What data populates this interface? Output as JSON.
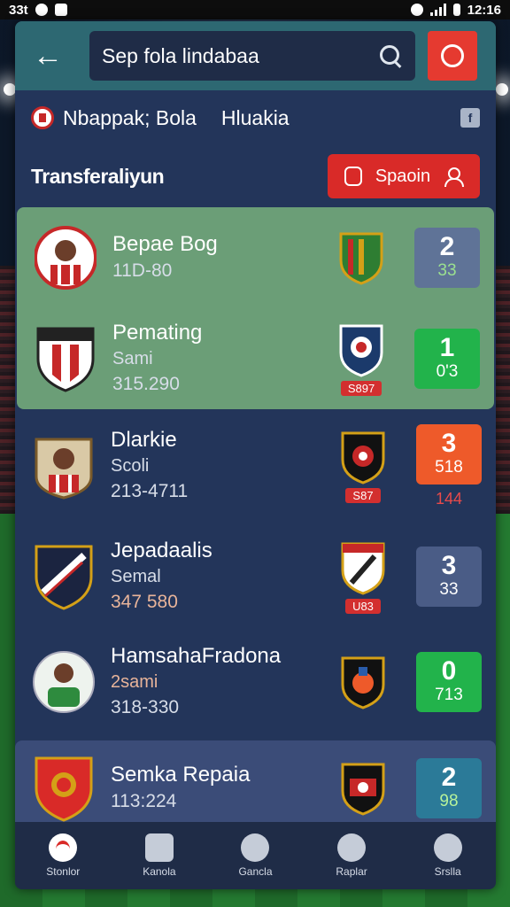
{
  "status_bar": {
    "left_text": "33t",
    "time": "12:16"
  },
  "topbar": {
    "search_placeholder": "Sep fola lindabaa"
  },
  "league": {
    "name": "Nbappak; Bola",
    "region": "Hluakia",
    "badge": "f"
  },
  "section": {
    "title": "Transferaliyun",
    "button_label": "Spaoin"
  },
  "rows": [
    {
      "name": "Bepae Bog",
      "position": "",
      "date": "11D-80",
      "score_main": "2",
      "score_sub": "33",
      "score_color": "#5f7397",
      "sub_color": "#9be08f",
      "team_tag": "",
      "below": ""
    },
    {
      "name": "Pemating",
      "position": "Sami",
      "date": "315.290",
      "score_main": "1",
      "score_sub": "0'3",
      "score_color": "#22b34b",
      "sub_color": "#ffffff",
      "team_tag": "S897",
      "below": ""
    },
    {
      "name": "Dlarkie",
      "position": "Scoli",
      "date": "213-4711",
      "score_main": "3",
      "score_sub": "518",
      "score_color": "#ee5a2a",
      "sub_color": "#ffffff",
      "team_tag": "S87",
      "below": "144"
    },
    {
      "name": "Jepadaalis",
      "position": "Semal",
      "date": "347 580",
      "score_main": "3",
      "score_sub": "33",
      "score_color": "#4a5c86",
      "sub_color": "#d7dde8",
      "team_tag": "U83",
      "below": ""
    },
    {
      "name": "HamsahaFradona",
      "position": "2sami",
      "date": "318-330",
      "score_main": "0",
      "score_sub": "713",
      "score_color": "#22b34b",
      "sub_color": "#ffffff",
      "team_tag": "",
      "below": ""
    },
    {
      "name": "Semka Repaia",
      "position": "",
      "date": "113:224",
      "score_main": "2",
      "score_sub": "98",
      "score_color": "#2b7a98",
      "sub_color": "#b6f29a",
      "team_tag": "",
      "below": ""
    }
  ],
  "bottom_nav": [
    {
      "label": "Stonlor",
      "icon": "ball-icon"
    },
    {
      "label": "Kanola",
      "icon": "calendar-icon"
    },
    {
      "label": "Gancla",
      "icon": "shield-icon"
    },
    {
      "label": "Raplar",
      "icon": "globe-icon"
    },
    {
      "label": "Srslla",
      "icon": "person-icon"
    }
  ]
}
